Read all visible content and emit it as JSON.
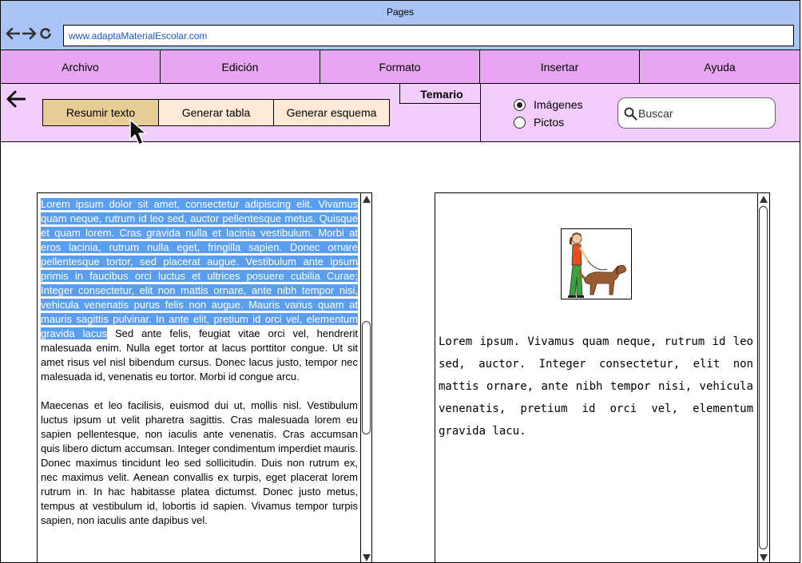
{
  "window": {
    "title": "Pages",
    "url": "www.adaptaMaterialEscolar.com"
  },
  "menu": {
    "items": [
      "Archivo",
      "Edición",
      "Formato",
      "Insertar",
      "Ayuda"
    ]
  },
  "toolbar": {
    "buttons": [
      "Resumir texto",
      "Generar tabla",
      "Generar esquema"
    ],
    "active_button": "Resumir texto",
    "tab_label": "Temario",
    "radio_options": [
      "Imágenes",
      "Pictos"
    ],
    "radio_selected": "Imágenes",
    "search_placeholder": "Buscar"
  },
  "left_panel": {
    "selected_text": "Lorem ipsum dolor sit amet, consectetur adipiscing elit. Vivamus quam neque, rutrum id leo sed, auctor pellentesque metus. Quisque et quam lorem. Cras gravida nulla et lacinia vestibulum. Morbi at eros lacinia, rutrum nulla eget, fringilla sapien. Donec ornare pellentesque tortor, sed placerat augue. Vestibulum ante ipsum primis in faucibus orci luctus et ultrices posuere cubilia Curae; Integer consectetur, elit non mattis ornare, ante nibh tempor nisi, vehicula venenatis purus felis non augue. Mauris varius quam at mauris sagittis pulvinar. In ante elit, pretium id orci vel, elementum gravida lacus",
    "rest_of_paragraph_1": " Sed ante felis, feugiat vitae orci vel, hendrerit malesuada enim. Nulla eget tortor at lacus porttitor congue. Ut sit amet risus vel nisl bibendum cursus. Donec lacus justo, tempor nec malesuada id, venenatis eu tortor. Morbi id congue arcu.",
    "paragraph_2": "Maecenas et leo facilisis, euismod dui ut, mollis nisl. Vestibulum luctus ipsum ut velit pharetra sagittis. Cras malesuada lorem eu sapien pellentesque, non iaculis ante venenatis. Cras accumsan quis libero dictum accumsan. Integer condimentum imperdiet mauris. Donec maximus tincidunt leo sed sollicitudin. Duis non rutrum ex, nec maximus velit. Aenean convallis ex turpis, eget placerat lorem rutrum in. In hac habitasse platea dictumst. Donec justo metus, tempus at vestibulum id, lobortis id sapien. Vivamus tempor turpis sapien, non iaculis ante dapibus vel."
  },
  "right_panel": {
    "picto_icon": "girl-walking-dog-picto",
    "summary_text": "Lorem ipsum. Vivamus quam neque, rutrum id leo sed, auctor. Integer consectetur, elit non mattis ornare, ante nibh tempor nisi, vehicula venenatis, pretium id orci vel, elementum gravida lacu."
  },
  "colors": {
    "title_bar": "#a9c4f5",
    "menu_bar": "#e8a6f2",
    "toolbar": "#f2ccfb",
    "button": "#fde9d6",
    "button_active": "#e8cc96",
    "selection": "#5a9ef0",
    "url_text": "#1a56c9"
  }
}
